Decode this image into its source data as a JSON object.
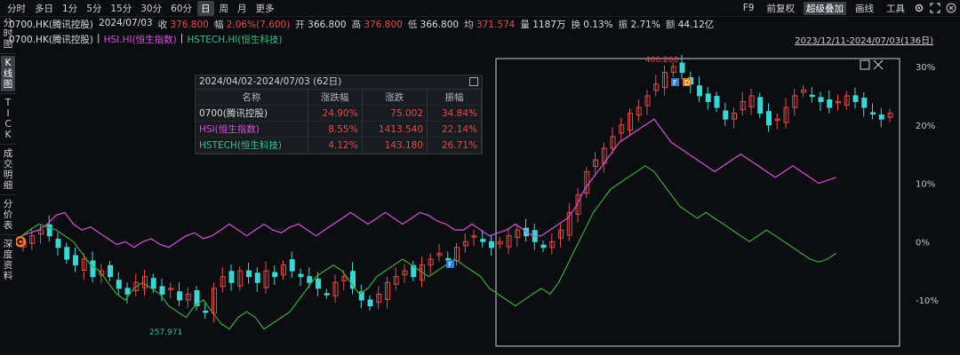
{
  "toolbar": {
    "periods": [
      "分时",
      "多日",
      "1分",
      "5分",
      "15分",
      "30分",
      "60分",
      "日",
      "周",
      "月",
      "更多"
    ],
    "active_period": "日",
    "right": {
      "f9": "F9",
      "fuquan": "前复权",
      "overlay": "超级叠加",
      "draw": "画线",
      "tools": "工具"
    }
  },
  "info": {
    "code": "0700.HK(腾讯控股)",
    "date": "2024/07/03",
    "close_label": "收",
    "close": "376.800",
    "amp_label": "幅",
    "change": "2.06%(7.600)",
    "open_label": "开",
    "open": "366.800",
    "high_label": "高",
    "high": "376.800",
    "low_label": "低",
    "low": "366.800",
    "avg_label": "均",
    "avg": "371.574",
    "vol_label": "量",
    "volume": "1187万",
    "turn_label": "换",
    "turnover": "0.13%",
    "swing_label": "振",
    "swing": "2.71%",
    "amt_label": "额",
    "amount": "44.12亿"
  },
  "legend": {
    "main": "0700.HK(腾讯控股)",
    "hsi": "HSI.HI(恒生指数)",
    "hstech": "HSTECH.HI(恒生科技)",
    "sep": "|"
  },
  "range_label": "2023/12/11-2024/07/03(136日)",
  "leftnav": [
    {
      "id": "fenshi",
      "label": "分时图"
    },
    {
      "id": "kline",
      "label": "K线图",
      "active": true
    },
    {
      "id": "tick",
      "label": "TICK"
    },
    {
      "id": "chengjiao",
      "label": "成交明细"
    },
    {
      "id": "fenjia",
      "label": "分价表"
    },
    {
      "id": "shendu",
      "label": "深度资料"
    }
  ],
  "stats": {
    "title": "2024/04/02-2024/07/03 (62日)",
    "headers": [
      "名称",
      "涨跌幅",
      "涨跌",
      "振幅"
    ],
    "rows": [
      {
        "name": "0700(腾讯控股)",
        "pct": "24.90%",
        "chg": "75.002",
        "amp": "34.84%",
        "color": "#dcdcdc"
      },
      {
        "name": "HSI(恒生指数)",
        "pct": "8.55%",
        "chg": "1413.540",
        "amp": "22.14%",
        "color": "#d84fd8"
      },
      {
        "name": "HSTECH(恒生科技)",
        "pct": "4.12%",
        "chg": "143.180",
        "amp": "26.71%",
        "color": "#2ec28b"
      }
    ]
  },
  "annotations": {
    "high": "400.200",
    "low": "257.971",
    "badge_f": "F",
    "badge_d": "D"
  },
  "chart_data": {
    "type": "line",
    "axis_ticks": [
      "30%",
      "20%",
      "10%",
      "0%",
      "-10%"
    ],
    "tick_values": [
      30,
      20,
      10,
      0,
      -10
    ],
    "series": [
      {
        "name": "0700.HK(腾讯控股)",
        "color": "#dcdcdc",
        "values": [
          0,
          1,
          2,
          1,
          -1,
          -3,
          -4,
          -3,
          -6,
          -5,
          -6,
          -8,
          -9,
          -7,
          -6,
          -8,
          -9,
          -8,
          -10,
          -9,
          -11,
          -12,
          -8,
          -6,
          -7,
          -5,
          -6,
          -7,
          -5,
          -6,
          -4,
          -5,
          -6,
          -7,
          -8,
          -9,
          -7,
          -6,
          -8,
          -10,
          -11,
          -9,
          -7,
          -6,
          -5,
          -6,
          -4,
          -3,
          -2,
          -3,
          -1,
          0,
          1,
          0,
          -1,
          0,
          1,
          2,
          1,
          0,
          -1,
          0,
          2,
          5,
          8,
          12,
          14,
          16,
          18,
          20,
          22,
          23,
          25,
          27,
          29,
          30,
          29,
          27,
          25,
          24,
          23,
          21,
          22,
          24,
          25,
          22,
          20,
          21,
          23,
          25,
          26,
          25,
          24,
          23,
          24,
          25,
          24,
          23,
          22,
          21,
          22
        ]
      },
      {
        "name": "HSI.HI(恒生指数)",
        "color": "#d84fd8",
        "values": [
          1,
          1.5,
          2,
          3,
          4.5,
          5,
          3,
          2,
          2.5,
          1.5,
          0.5,
          -0.5,
          0,
          -1,
          0,
          0.5,
          -0.5,
          -1,
          0,
          1,
          1.5,
          0.5,
          1,
          2,
          3,
          2,
          1,
          2,
          3,
          2,
          1.5,
          2.5,
          3,
          2,
          1,
          2,
          3,
          4,
          5,
          4,
          3,
          4,
          5,
          4,
          3,
          4,
          5,
          4.5,
          3.5,
          3,
          2,
          2,
          3,
          2,
          1,
          1.5,
          2,
          3,
          2,
          1,
          1,
          2,
          3,
          4,
          6,
          9,
          11,
          13,
          15,
          17,
          18,
          19,
          20,
          21,
          19,
          17,
          16,
          15,
          14,
          13,
          12,
          13,
          14,
          15,
          14,
          13,
          12,
          11,
          12,
          13,
          12,
          11,
          10,
          10.5,
          11
        ]
      },
      {
        "name": "HSTECH.HI(恒生科技)",
        "color": "#3aa83a",
        "values": [
          1,
          2,
          3,
          2.5,
          2,
          1,
          0,
          -2,
          -4,
          -5,
          -7,
          -9,
          -10,
          -8,
          -7,
          -8,
          -9,
          -11,
          -12,
          -13,
          -11,
          -10,
          -12,
          -14,
          -15,
          -13,
          -12,
          -13,
          -15,
          -14,
          -13,
          -12,
          -10,
          -8,
          -6,
          -5,
          -4,
          -5,
          -7,
          -9,
          -8,
          -6,
          -5,
          -4,
          -3,
          -4,
          -5,
          -6,
          -5,
          -4,
          -3,
          -4,
          -5,
          -6,
          -8,
          -9,
          -10,
          -11,
          -10,
          -9,
          -8,
          -9,
          -7,
          -4,
          -1,
          2,
          5,
          7,
          9,
          10,
          11,
          12,
          13,
          12,
          10,
          8,
          6,
          5,
          4,
          5,
          4,
          3,
          2,
          1,
          0,
          1,
          2,
          1,
          0,
          -1,
          -2,
          -3,
          -3.5,
          -3,
          -2
        ]
      }
    ]
  }
}
